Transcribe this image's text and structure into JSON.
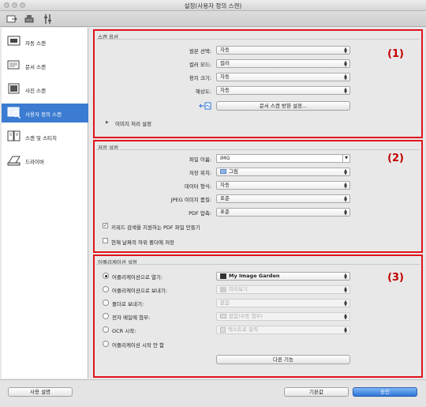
{
  "window": {
    "title": "설정(사용자 정의 스캔)"
  },
  "toolbar": {
    "icons": [
      "scan-from-computer-icon",
      "scan-from-operation-panel-icon",
      "general-settings-icon"
    ]
  },
  "sidebar": {
    "items": [
      {
        "label": "자동 스캔",
        "icon": "auto-scan-icon"
      },
      {
        "label": "문서 스캔",
        "icon": "document-scan-icon"
      },
      {
        "label": "사진 스캔",
        "icon": "photo-scan-icon"
      },
      {
        "label": "사용자 정의 스캔",
        "icon": "custom-scan-icon",
        "selected": true
      },
      {
        "label": "스캔 및 스티치",
        "icon": "scan-stitch-icon"
      },
      {
        "label": "드라이버",
        "icon": "driver-icon"
      }
    ]
  },
  "scan_options": {
    "header": "스캔 옵션",
    "number": "(1)",
    "source_label": "원본 선택:",
    "source_value": "자동",
    "color_label": "컬러 모드:",
    "color_value": "컬러",
    "paper_label": "용지 크기:",
    "paper_value": "자동",
    "res_label": "해상도:",
    "res_value": "자동",
    "orientation_button": "문서 스캔 방향 설정...",
    "image_processing_label": "이미지 처리 설정"
  },
  "save_settings": {
    "header": "저장 설정",
    "number": "(2)",
    "filename_label": "파일 이름:",
    "filename_value": "IMG",
    "location_label": "저장 위치:",
    "location_value": "그림",
    "format_label": "데이터 형식:",
    "format_value": "자동",
    "jpeg_label": "JPEG 이미지 품질:",
    "jpeg_value": "표준",
    "pdf_label": "PDF 압축:",
    "pdf_value": "표준",
    "keyword_pdf_label": "키워드 검색을 지원하는 PDF 파일 만들기",
    "keyword_pdf_checked": true,
    "subfolder_label": "현재 날짜의 하위 폴더에 저장",
    "subfolder_checked": false
  },
  "app_settings": {
    "header": "어플리케이션 설정",
    "number": "(3)",
    "open_label": "어플리케이션으로 열기:",
    "open_value": "My Image Garden",
    "send_app_label": "어플리케이션으로 보내기:",
    "send_app_value": "미리보기",
    "send_folder_label": "폴더로 보내기:",
    "send_folder_value": "없음",
    "email_label": "전자 메일에 첨부:",
    "email_value": "없음(수동 첨부)",
    "ocr_label": "OCR 시작:",
    "ocr_value": "텍스트로 출력",
    "no_app_label": "어플리케이션 시작 안 함",
    "more_button": "다른 기능"
  },
  "footer": {
    "help": "사용 설명",
    "defaults": "기본값",
    "ok": "승인"
  }
}
